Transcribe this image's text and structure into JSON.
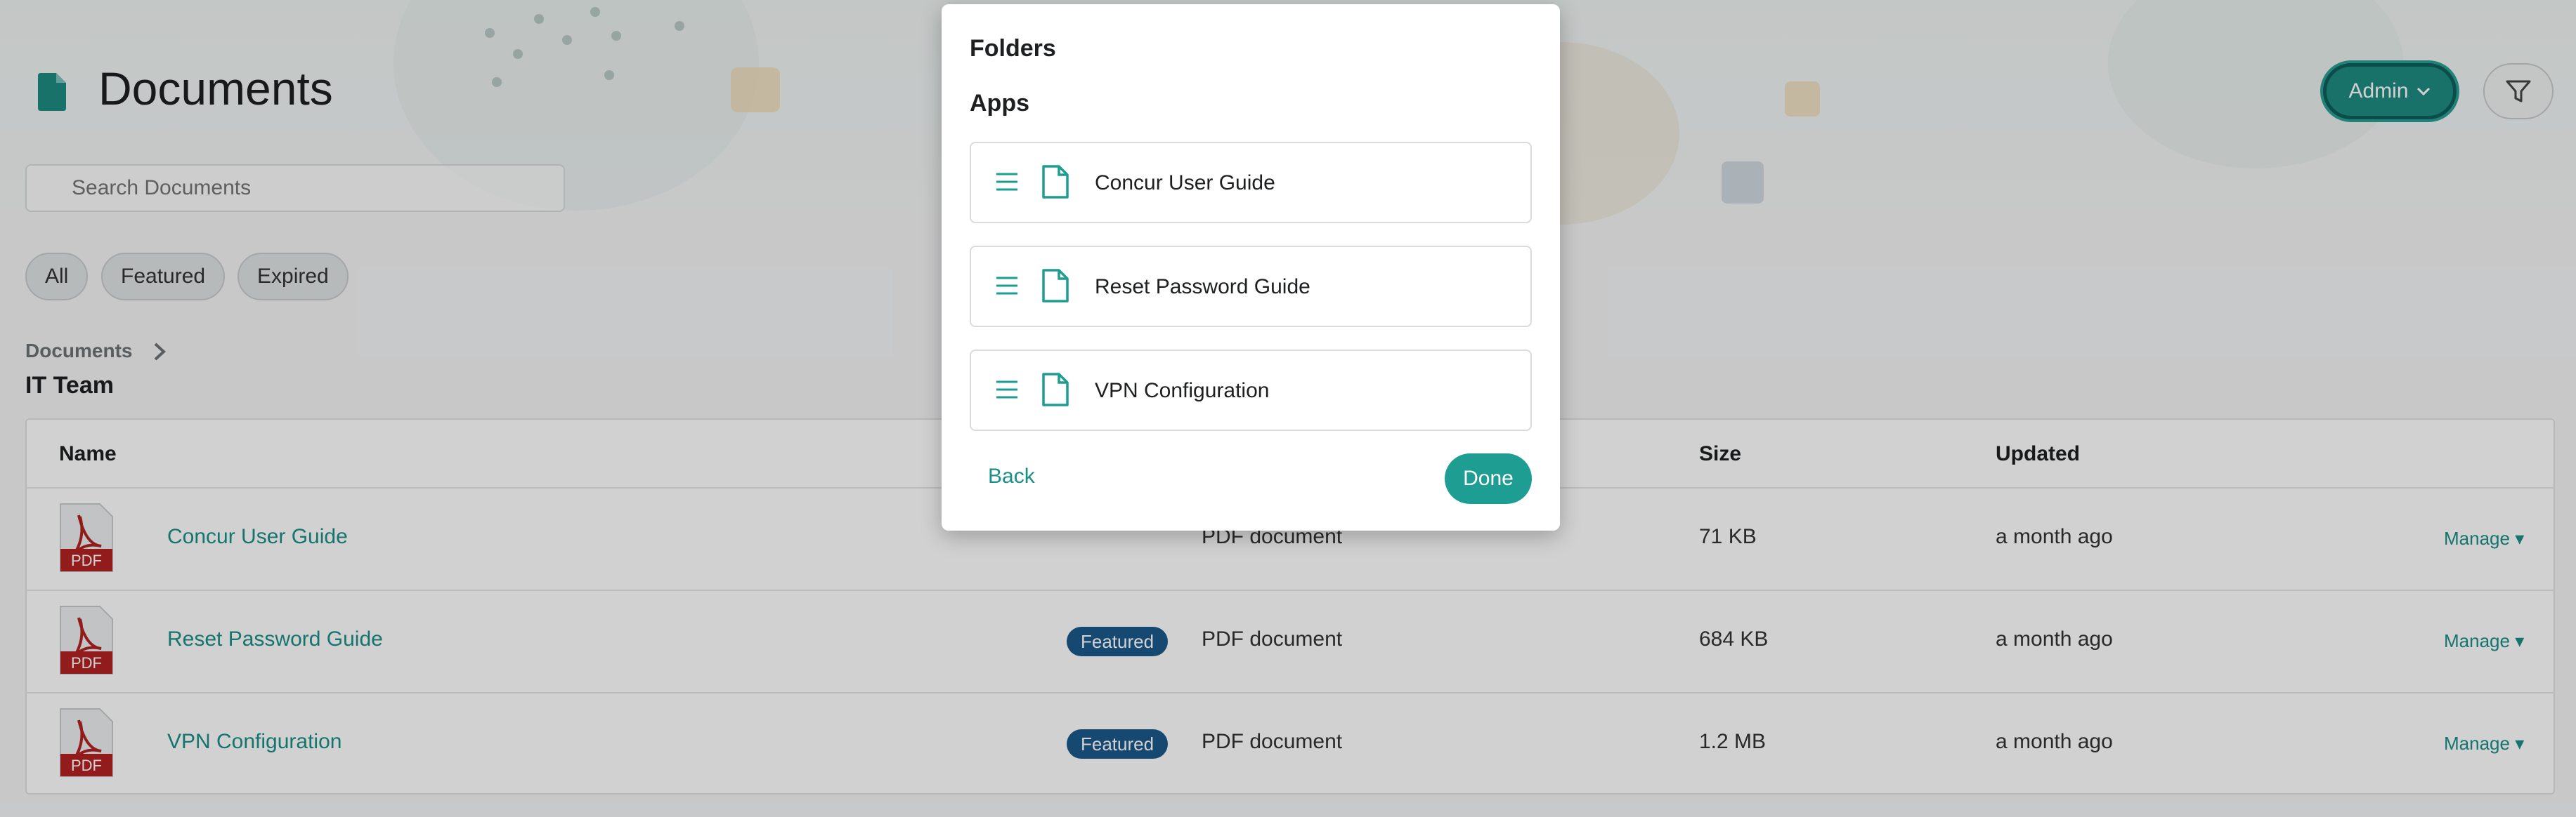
{
  "page": {
    "title": "Documents",
    "icon": "document-icon",
    "search_placeholder": "Search Documents",
    "filters": [
      "All",
      "Featured",
      "Expired"
    ]
  },
  "header": {
    "admin_label": "Admin",
    "admin_icon": "chevron-down-icon",
    "filter_icon": "filter-icon"
  },
  "breadcrumb": {
    "root": "Documents",
    "current": "IT Team"
  },
  "table": {
    "headers": {
      "name": "Name",
      "size": "Size",
      "updated": "Updated"
    },
    "rows": [
      {
        "name": "Concur User Guide",
        "badge": "",
        "type": "PDF document",
        "size": "71 KB",
        "updated": "a month ago",
        "action": "Manage",
        "icon_label": "PDF"
      },
      {
        "name": "Reset Password Guide",
        "badge": "Featured",
        "type": "PDF document",
        "size": "684 KB",
        "updated": "a month ago",
        "action": "Manage",
        "icon_label": "PDF"
      },
      {
        "name": "VPN Configuration",
        "badge": "Featured",
        "type": "PDF document",
        "size": "1.2 MB",
        "updated": "a month ago",
        "action": "Manage",
        "icon_label": "PDF"
      }
    ]
  },
  "modal": {
    "folders_heading": "Folders",
    "apps_heading": "Apps",
    "apps": [
      {
        "label": "Concur User Guide"
      },
      {
        "label": "Reset Password Guide"
      },
      {
        "label": "VPN Configuration"
      }
    ],
    "back_label": "Back",
    "done_label": "Done"
  },
  "colors": {
    "accent": "#1e9e92",
    "link": "#1a8f87",
    "badge": "#1b5a8c",
    "pdf_red": "#b22222"
  }
}
